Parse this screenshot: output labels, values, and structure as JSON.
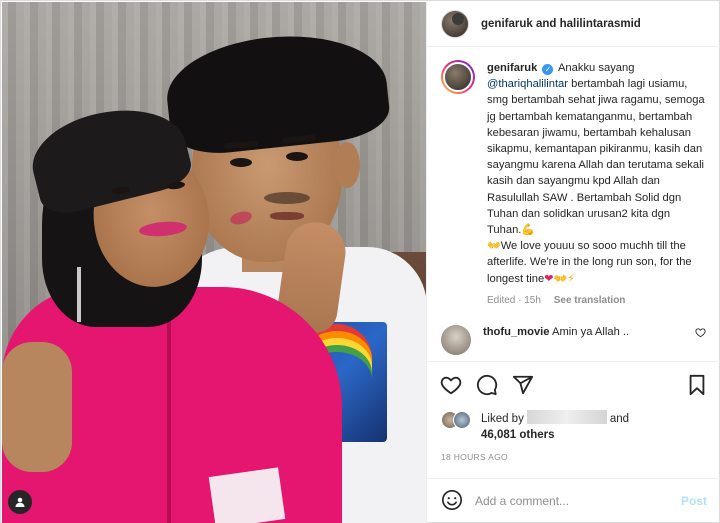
{
  "header": {
    "user1": "genifaruk",
    "and": "and",
    "user2": "halilintarasmid"
  },
  "caption": {
    "username": "genifaruk",
    "text_before_mention": "Anakku sayang",
    "mention": "@thariqhalilintar",
    "text_after_mention": "bertambah lagi usiamu, smg bertambah sehat jiwa ragamu, semoga jg bertambah kematanganmu, bertambah kebesaran jiwamu, bertambah kehalusan sikapmu, kemantapan pikiranmu, kasih dan sayangmu karena Allah dan terutama sekali kasih dan sayangmu kpd Allah dan Rasulullah SAW . Bertambah Solid dgn Tuhan dan solidkan urusan2 kita dgn Tuhan.",
    "line2": "We love youuu so sooo muchh till the afterlife. We're in the long run son, for the longest tine",
    "edited": "Edited · 15h",
    "see_translation": "See translation"
  },
  "comment": {
    "username": "thofu_movie",
    "text": "Amin ya Allah .."
  },
  "likes": {
    "liked_by": "Liked by",
    "and": "and",
    "others": "46,081 others"
  },
  "timestamp": "18 HOURS AGO",
  "add_comment": {
    "placeholder": "Add a comment...",
    "post": "Post"
  },
  "icons": {
    "like": "heart-icon",
    "comment": "comment-icon",
    "share": "share-icon",
    "save": "bookmark-icon",
    "emoji": "emoji-icon",
    "user_tag": "user-tag-icon"
  },
  "colors": {
    "link": "#00376b",
    "verified": "#3897f0",
    "post_disabled": "#b2dffc",
    "muted": "#8e8e8e"
  }
}
